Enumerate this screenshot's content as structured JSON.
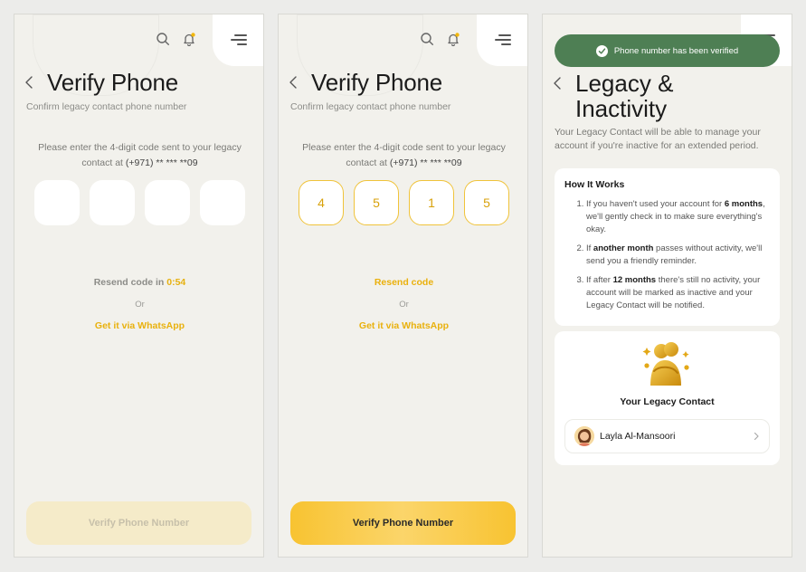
{
  "verify": {
    "title": "Verify Phone",
    "subtitle": "Confirm legacy contact phone number",
    "instruction": "Please enter the 4-digit code sent to your legacy contact at",
    "phone": "(+971) ** *** **09",
    "or": "Or",
    "whatsapp": "Get it via WhatsApp",
    "cta": "Verify Phone Number"
  },
  "screen1": {
    "resend_prefix": "Resend code in ",
    "timer": "0:54",
    "code": [
      "",
      "",
      "",
      ""
    ],
    "cta_state": "disabled"
  },
  "screen2": {
    "resend": "Resend code",
    "code": [
      "4",
      "5",
      "1",
      "5"
    ],
    "cta_state": "enabled"
  },
  "screen3": {
    "toast": "Phone number has been verified",
    "title_line1": "Legacy &",
    "title_line2": "Inactivity",
    "description": "Your Legacy Contact will be able to manage your account if you're inactive for an extended period.",
    "how_title": "How It Works",
    "steps": [
      {
        "a": "If you haven't used your account for ",
        "b": "6 months",
        "c": ", we'll gently check in to make sure everything's okay."
      },
      {
        "a": "If ",
        "b": "another month",
        "c": " passes without activity, we'll send you a friendly reminder."
      },
      {
        "a": "If after ",
        "b": "12 months",
        "c": " there's still no activity, your account will be marked as inactive and your Legacy Contact will be notified."
      }
    ],
    "legacy_title": "Your Legacy Contact",
    "contact_name": "Layla Al-Mansoori"
  },
  "icons": [
    "search-icon",
    "bell-icon",
    "menu-icon",
    "back-icon",
    "check-icon",
    "chevron-right-icon",
    "hug-illustration-icon",
    "avatar"
  ],
  "colors": {
    "accent": "#f8c331",
    "accent_text": "#e9b10d",
    "success": "#4e7f54",
    "notification_dot": "#f2b70d"
  }
}
